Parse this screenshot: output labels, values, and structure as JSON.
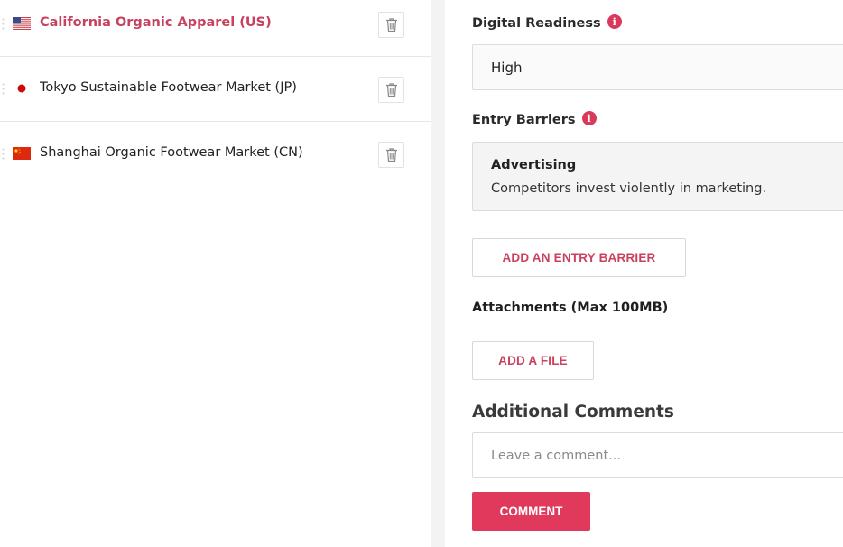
{
  "markets": [
    {
      "name": "California Organic Apparel (US)",
      "country": "US",
      "flag_icon": "us-flag-icon",
      "active": true
    },
    {
      "name": "Tokyo Sustainable Footwear Market (JP)",
      "country": "JP",
      "flag_icon": "jp-flag-icon",
      "active": false
    },
    {
      "name": "Shanghai Organic Footwear Market (CN)",
      "country": "CN",
      "flag_icon": "cn-flag-icon",
      "active": false
    }
  ],
  "details": {
    "digital_readiness": {
      "label": "Digital Readiness",
      "value": "High",
      "info_icon": "i"
    },
    "entry_barriers": {
      "label": "Entry Barriers",
      "info_icon": "i",
      "items": [
        {
          "title": "Advertising",
          "description": "Competitors invest violently in marketing."
        }
      ],
      "add_button": "ADD AN ENTRY BARRIER"
    },
    "attachments": {
      "label": "Attachments (Max 100MB)",
      "add_button": "ADD A FILE"
    },
    "comments": {
      "heading": "Additional Comments",
      "placeholder": "Leave a comment...",
      "submit_button": "COMMENT"
    }
  },
  "colors": {
    "accent": "#e0395b",
    "accent_text": "#c8415f",
    "info_icon": "#d93a5b"
  }
}
